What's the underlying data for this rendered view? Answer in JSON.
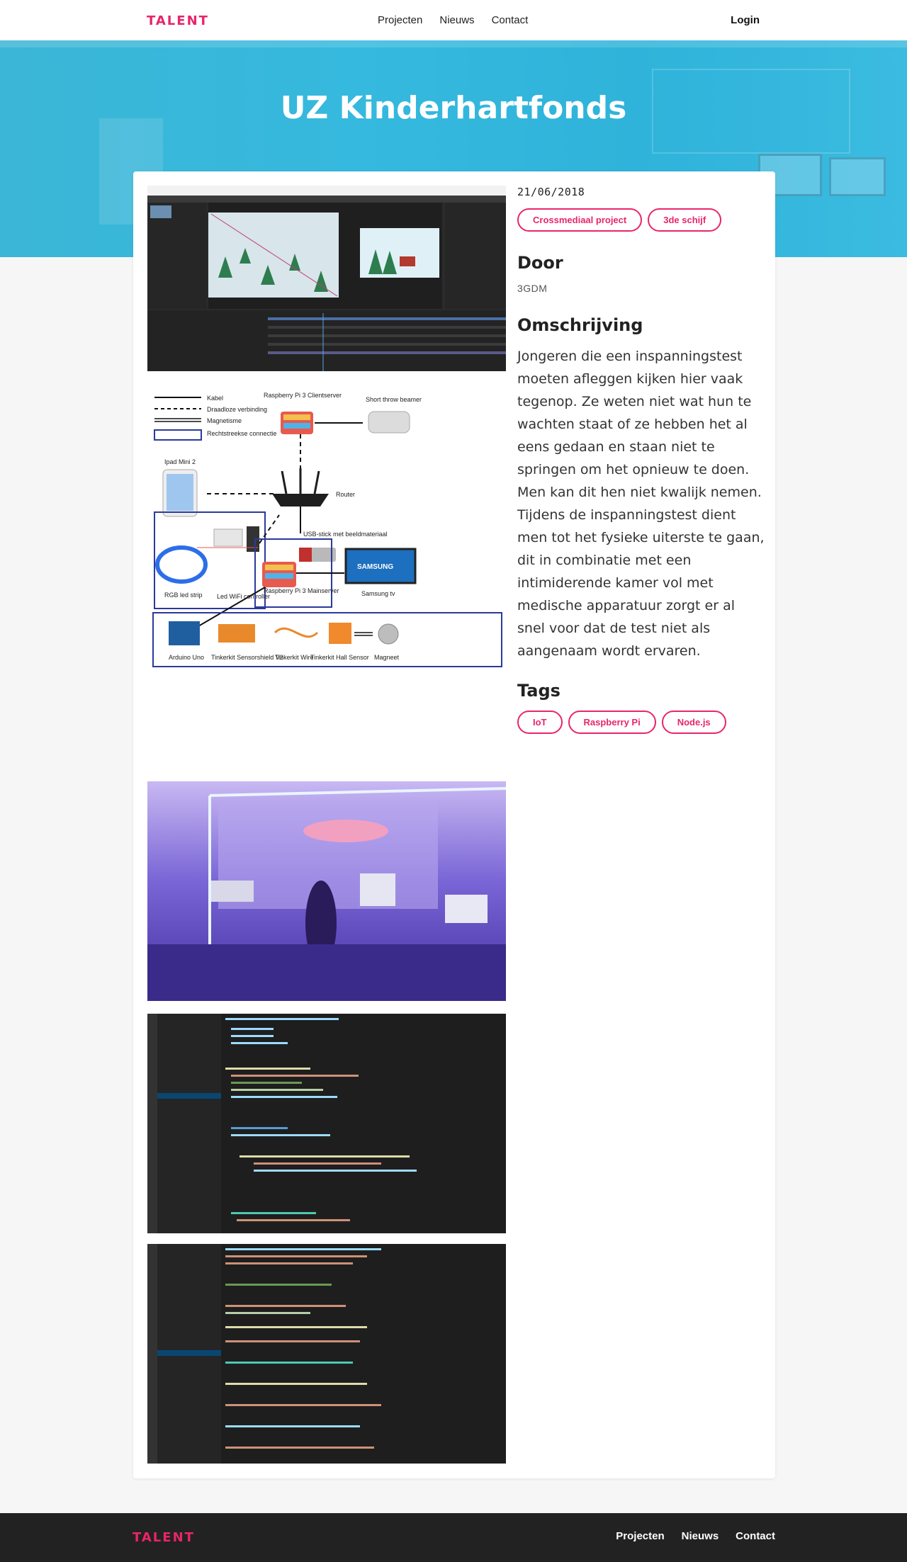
{
  "nav": {
    "logo": "TALENT",
    "links": [
      "Projecten",
      "Nieuws",
      "Contact"
    ],
    "login": "Login"
  },
  "hero": {
    "title": "UZ Kinderhartfonds"
  },
  "project": {
    "date": "21/06/2018",
    "categories": [
      "Crossmediaal project",
      "3de schijf"
    ],
    "by_heading": "Door",
    "by": "3GDM",
    "description_heading": "Omschrijving",
    "description": "Jongeren die een inspanningstest moeten afleggen kijken hier vaak tegenop. Ze weten niet wat hun te wachten staat of ze hebben het al eens gedaan en staan niet te springen om het opnieuw te doen. Men kan dit hen niet kwalijk nemen. Tijdens de inspanningstest dient men tot het fysieke uiterste te gaan, dit in combinatie met een intimiderende kamer vol met medische apparatuur zorgt er al snel voor dat de test niet als aangenaam wordt ervaren.",
    "tags_heading": "Tags",
    "tags": [
      "IoT",
      "Raspberry Pi",
      "Node.js"
    ]
  },
  "diagram": {
    "legend": [
      "Kabel",
      "Draadloze verbinding",
      "Magnetisme",
      "Rechtstreekse connectie"
    ],
    "nodes": {
      "rpi_client": "Raspberry Pi 3 Clientserver",
      "beamer": "Short throw beamer",
      "ipad": "Ipad Mini 2",
      "router": "Router",
      "led_strip": "RGB led strip",
      "led_controller": "Led WiFi controller",
      "usb": "USB-stick met beeldmateriaal",
      "rpi_main": "Raspberry Pi 3 Mainserver",
      "tv": "Samsung tv",
      "samsung": "SAMSUNG",
      "arduino": "Arduino Uno",
      "shield": "Tinkerkit Sensorshield V2",
      "wire": "Tinkerkit Wire",
      "hall": "Tinkerkit Hall Sensor",
      "magnet": "Magneet"
    }
  },
  "footer": {
    "logo": "TALENT",
    "links": [
      "Projecten",
      "Nieuws",
      "Contact"
    ]
  }
}
